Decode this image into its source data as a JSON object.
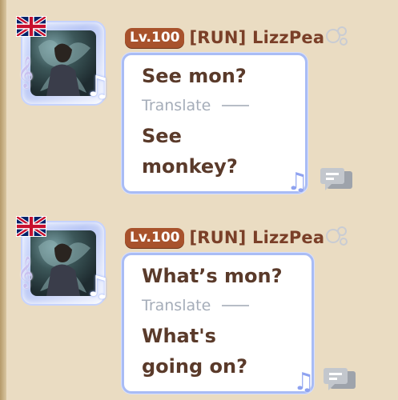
{
  "messages": [
    {
      "level": "Lv.100",
      "username": "[RUN] LizzPea",
      "original": "See mon?",
      "translate_label": "Translate",
      "translated_lines": [
        "See",
        "monkey?"
      ]
    },
    {
      "level": "Lv.100",
      "username": "[RUN] LizzPea",
      "original": "What’s mon?",
      "translate_label": "Translate",
      "translated_lines": [
        "What's",
        "going on?"
      ]
    }
  ],
  "icons": {
    "flag": "uk-flag-icon",
    "clef": "treble-clef-icon",
    "note": "music-note-icon",
    "bubbles": "bubbles-icon",
    "chat": "chat-icon"
  },
  "colors": {
    "background": "#eadcc2",
    "level_badge": "#a8522c",
    "username": "#7a3f28",
    "bubble_border": "#a9bcf5",
    "text": "#5a3a2a",
    "translate": "#a5adb9"
  }
}
